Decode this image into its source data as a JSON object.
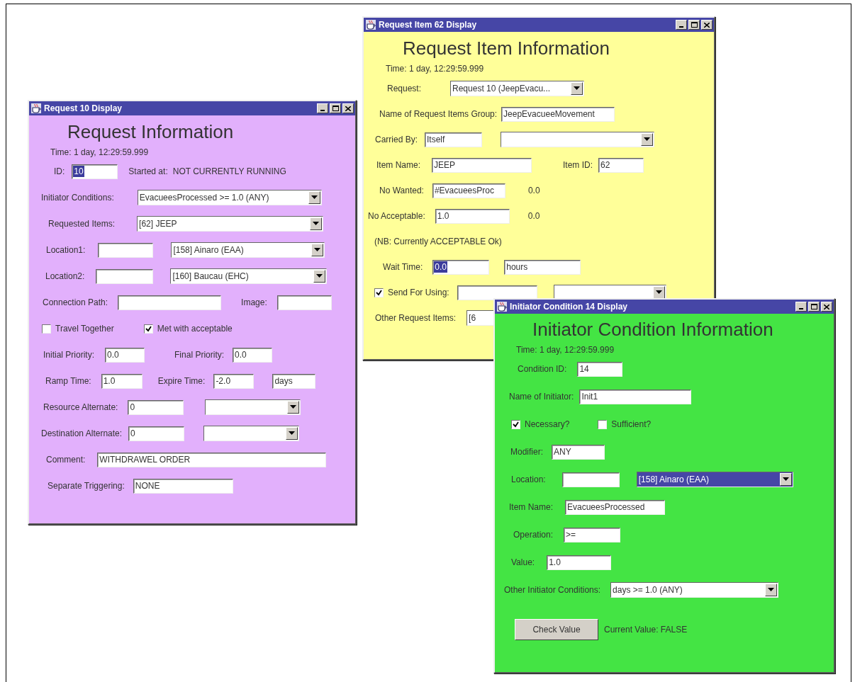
{
  "windows": [
    {
      "title": "Request 10 Display",
      "color": "#e2b0fc",
      "heading": "Request Information",
      "time": "Time: 1 day, 12:29:59.999",
      "rows": [
        {
          "items": [
            {
              "kind": "label",
              "text": "ID:"
            },
            {
              "kind": "field",
              "value": "10",
              "selected": true
            },
            {
              "kind": "label",
              "text": "Started at:"
            },
            {
              "kind": "text",
              "text": "NOT CURRENTLY RUNNING"
            }
          ]
        },
        {
          "items": [
            {
              "kind": "label",
              "text": "Initiator Conditions:"
            },
            {
              "kind": "combo",
              "value": "EvacueesProcessed >= 1.0 (ANY)",
              "selected": false
            }
          ]
        },
        {
          "items": [
            {
              "kind": "label",
              "text": "Requested Items:"
            },
            {
              "kind": "combo",
              "value": "[62] JEEP",
              "selected": false
            }
          ]
        },
        {
          "items": [
            {
              "kind": "label",
              "text": "Location1:"
            },
            {
              "kind": "field"
            },
            {
              "kind": "combo",
              "value": "[158] Ainaro (EAA)",
              "selected": false
            }
          ]
        },
        {
          "items": [
            {
              "kind": "label",
              "text": "Location2:"
            },
            {
              "kind": "field"
            },
            {
              "kind": "combo",
              "value": "[160] Baucau (EHC)",
              "selected": false
            }
          ]
        },
        {
          "items": [
            {
              "kind": "label",
              "text": "Connection Path:"
            },
            {
              "kind": "field"
            },
            {
              "kind": "label",
              "text": "Image:"
            },
            {
              "kind": "field"
            }
          ]
        },
        {
          "items": [
            {
              "kind": "checkbox",
              "label": "Travel Together",
              "checked": false
            },
            {
              "kind": "checkbox",
              "label": "Met with acceptable",
              "checked": true
            }
          ]
        },
        {
          "items": [
            {
              "kind": "label",
              "text": "Initial Priority:"
            },
            {
              "kind": "field",
              "value": "0.0",
              "selected": false
            },
            {
              "kind": "label",
              "text": "Final Priority:"
            },
            {
              "kind": "field",
              "value": "0.0",
              "selected": false
            }
          ]
        },
        {
          "items": [
            {
              "kind": "label",
              "text": "Ramp Time:"
            },
            {
              "kind": "field",
              "value": "1.0",
              "selected": false
            },
            {
              "kind": "label",
              "text": "Expire Time:"
            },
            {
              "kind": "field",
              "value": "-2.0",
              "selected": false
            },
            {
              "kind": "field",
              "value": "days",
              "selected": false
            }
          ]
        },
        {
          "items": [
            {
              "kind": "label",
              "text": "Resource Alternate:"
            },
            {
              "kind": "field",
              "value": "0",
              "selected": false
            },
            {
              "kind": "combo",
              "selected": false
            }
          ]
        },
        {
          "items": [
            {
              "kind": "label",
              "text": "Destination Alternate:"
            },
            {
              "kind": "field",
              "value": "0",
              "selected": false
            },
            {
              "kind": "combo",
              "selected": false
            }
          ]
        },
        {
          "items": [
            {
              "kind": "label",
              "text": "Comment:"
            },
            {
              "kind": "field",
              "value": "WITHDRAWEL ORDER",
              "selected": false
            }
          ]
        },
        {
          "items": [
            {
              "kind": "label",
              "text": "Separate Triggering:"
            },
            {
              "kind": "field",
              "value": "NONE",
              "selected": false
            }
          ]
        }
      ]
    },
    {
      "title": "Request Item 62 Display",
      "color": "#ffff99",
      "heading": "Request Item Information",
      "time": "Time: 1 day, 12:29:59.999",
      "rows": [
        {
          "items": [
            {
              "kind": "label",
              "text": "Request:"
            },
            {
              "kind": "combo",
              "value": "Request 10 (JeepEvacu...",
              "selected": false
            }
          ]
        },
        {
          "items": [
            {
              "kind": "label",
              "text": "Name of Request Items Group:"
            },
            {
              "kind": "field",
              "value": "JeepEvacueeMovement",
              "selected": false
            }
          ]
        },
        {
          "items": [
            {
              "kind": "label",
              "text": "Carried By:"
            },
            {
              "kind": "field",
              "value": "Itself",
              "selected": false
            },
            {
              "kind": "combo",
              "selected": false
            }
          ]
        },
        {
          "items": [
            {
              "kind": "label",
              "text": "Item Name:"
            },
            {
              "kind": "field",
              "value": "JEEP",
              "selected": false
            },
            {
              "kind": "label",
              "text": "Item ID:"
            },
            {
              "kind": "field",
              "value": "62",
              "selected": false
            }
          ]
        },
        {
          "items": [
            {
              "kind": "label",
              "text": "No Wanted:"
            },
            {
              "kind": "field",
              "value": "#EvacueesProc",
              "selected": false
            },
            {
              "kind": "text",
              "text": "0.0"
            }
          ]
        },
        {
          "items": [
            {
              "kind": "label",
              "text": "No Acceptable:"
            },
            {
              "kind": "field",
              "value": "1.0",
              "selected": false
            },
            {
              "kind": "text",
              "text": "0.0"
            }
          ]
        },
        {
          "items": [
            {
              "kind": "text",
              "text": "(NB:  Currently ACCEPTABLE Ok)"
            }
          ]
        },
        {
          "items": [
            {
              "kind": "label",
              "text": "Wait Time:"
            },
            {
              "kind": "field",
              "value": "0.0",
              "selected": true
            },
            {
              "kind": "field",
              "value": "hours",
              "selected": false
            }
          ]
        },
        {
          "items": [
            {
              "kind": "checkbox",
              "label": "Send For Using:",
              "checked": true
            },
            {
              "kind": "field"
            },
            {
              "kind": "combo",
              "selected": false
            }
          ]
        },
        {
          "items": [
            {
              "kind": "label",
              "text": "Other Request Items:"
            },
            {
              "kind": "combo",
              "value": "[6",
              "selected": false
            }
          ]
        }
      ]
    },
    {
      "title": "Initiator Condition 14 Display",
      "color": "#44e444",
      "heading": "Initiator Condition Information",
      "time": "Time: 1 day, 12:29:59.999",
      "rows": [
        {
          "items": [
            {
              "kind": "label",
              "text": "Condition ID:"
            },
            {
              "kind": "field",
              "value": "14",
              "selected": false
            }
          ]
        },
        {
          "items": [
            {
              "kind": "label",
              "text": "Name of Initiator:"
            },
            {
              "kind": "field",
              "value": "Init1",
              "selected": false
            }
          ]
        },
        {
          "items": [
            {
              "kind": "checkbox",
              "label": "Necessary?",
              "checked": true
            },
            {
              "kind": "checkbox",
              "label": "Sufficient?",
              "checked": false
            }
          ]
        },
        {
          "items": [
            {
              "kind": "label",
              "text": "Modifier:"
            },
            {
              "kind": "field",
              "value": "ANY",
              "selected": false
            }
          ]
        },
        {
          "items": [
            {
              "kind": "label",
              "text": "Location:"
            },
            {
              "kind": "field"
            },
            {
              "kind": "combo",
              "value": "[158] Ainaro (EAA)",
              "selected": true
            }
          ]
        },
        {
          "items": [
            {
              "kind": "label",
              "text": "Item Name:"
            },
            {
              "kind": "field",
              "value": "EvacueesProcessed",
              "selected": false
            }
          ]
        },
        {
          "items": [
            {
              "kind": "label",
              "text": "Operation:"
            },
            {
              "kind": "field",
              "value": ">=",
              "selected": false
            }
          ]
        },
        {
          "items": [
            {
              "kind": "label",
              "text": "Value:"
            },
            {
              "kind": "field",
              "value": "1.0",
              "selected": false
            }
          ]
        },
        {
          "items": [
            {
              "kind": "label",
              "text": "Other Initiator Conditions:"
            },
            {
              "kind": "combo",
              "value": "days >= 1.0 (ANY)",
              "selected": false
            }
          ]
        },
        {
          "items": [
            {
              "kind": "button",
              "label": "Check Value"
            },
            {
              "kind": "text",
              "text": "Current Value: FALSE"
            }
          ]
        }
      ]
    }
  ]
}
